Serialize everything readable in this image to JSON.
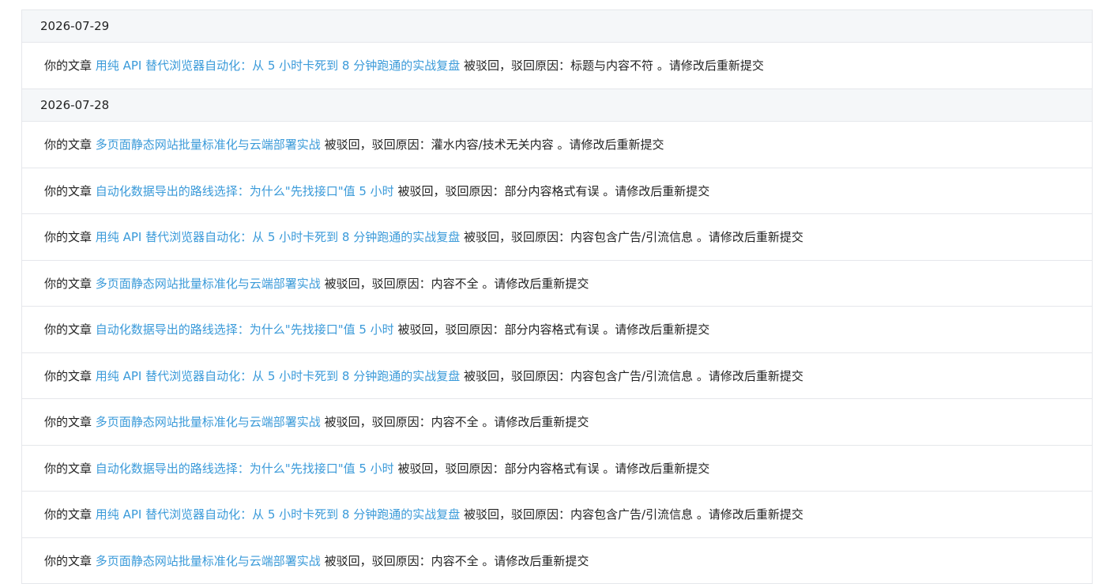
{
  "groups": [
    {
      "date": "2026-07-29",
      "items": [
        {
          "prefix": "你的文章",
          "title": "用纯 API 替代浏览器自动化：从 5 小时卡死到 8 分钟跑通的实战复盘",
          "mid": "被驳回，驳回原因：",
          "reason": "标题与内容不符",
          "suffix": "。请修改后重新提交"
        }
      ]
    },
    {
      "date": "2026-07-28",
      "items": [
        {
          "prefix": "你的文章",
          "title": "多页面静态网站批量标准化与云端部署实战",
          "mid": "被驳回，驳回原因：",
          "reason": "灌水内容/技术无关内容",
          "suffix": "。请修改后重新提交"
        },
        {
          "prefix": "你的文章",
          "title": "自动化数据导出的路线选择：为什么\"先找接口\"值 5 小时",
          "mid": "被驳回，驳回原因：",
          "reason": "部分内容格式有误",
          "suffix": "。请修改后重新提交"
        },
        {
          "prefix": "你的文章",
          "title": "用纯 API 替代浏览器自动化：从 5 小时卡死到 8 分钟跑通的实战复盘",
          "mid": "被驳回，驳回原因：",
          "reason": "内容包含广告/引流信息",
          "suffix": "。请修改后重新提交"
        },
        {
          "prefix": "你的文章",
          "title": "多页面静态网站批量标准化与云端部署实战",
          "mid": "被驳回，驳回原因：",
          "reason": "内容不全",
          "suffix": "。请修改后重新提交"
        },
        {
          "prefix": "你的文章",
          "title": "自动化数据导出的路线选择：为什么\"先找接口\"值 5 小时",
          "mid": "被驳回，驳回原因：",
          "reason": "部分内容格式有误",
          "suffix": "。请修改后重新提交"
        },
        {
          "prefix": "你的文章",
          "title": "用纯 API 替代浏览器自动化：从 5 小时卡死到 8 分钟跑通的实战复盘",
          "mid": "被驳回，驳回原因：",
          "reason": "内容包含广告/引流信息",
          "suffix": "。请修改后重新提交"
        },
        {
          "prefix": "你的文章",
          "title": "多页面静态网站批量标准化与云端部署实战",
          "mid": "被驳回，驳回原因：",
          "reason": "内容不全",
          "suffix": "。请修改后重新提交"
        },
        {
          "prefix": "你的文章",
          "title": "自动化数据导出的路线选择：为什么\"先找接口\"值 5 小时",
          "mid": "被驳回，驳回原因：",
          "reason": "部分内容格式有误",
          "suffix": "。请修改后重新提交"
        },
        {
          "prefix": "你的文章",
          "title": "用纯 API 替代浏览器自动化：从 5 小时卡死到 8 分钟跑通的实战复盘",
          "mid": "被驳回，驳回原因：",
          "reason": "内容包含广告/引流信息",
          "suffix": "。请修改后重新提交"
        },
        {
          "prefix": "你的文章",
          "title": "多页面静态网站批量标准化与云端部署实战",
          "mid": "被驳回，驳回原因：",
          "reason": "内容不全",
          "suffix": "。请修改后重新提交"
        }
      ]
    }
  ],
  "colors": {
    "link": "#3a9ad9",
    "text": "#222222",
    "date_bg": "#f5f7f9",
    "border": "#e5e7eb"
  }
}
